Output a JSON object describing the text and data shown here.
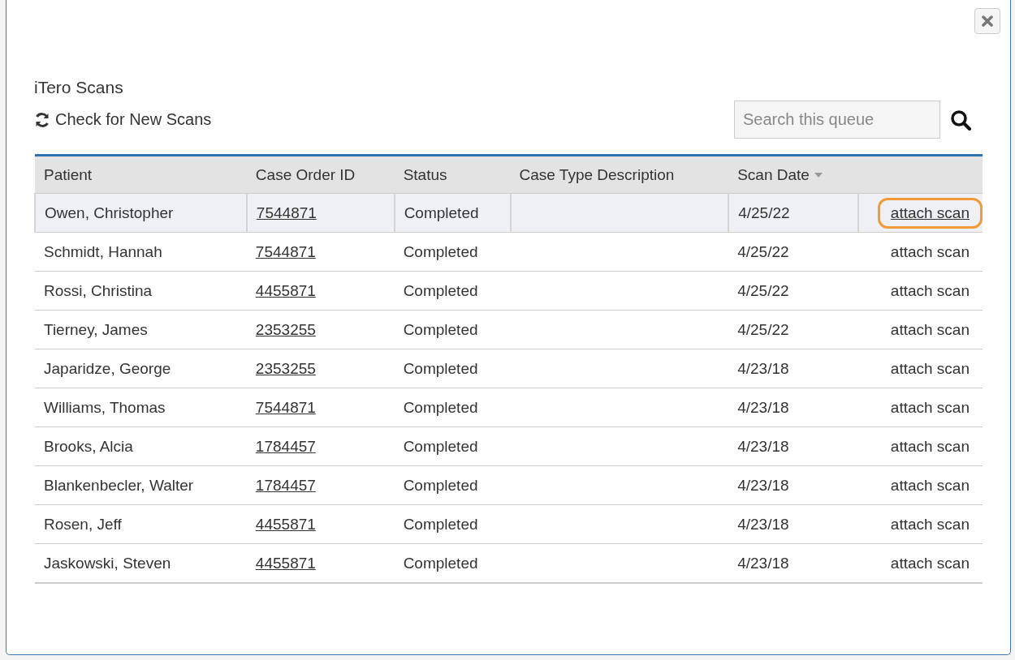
{
  "dialog": {
    "title": "iTero Scans",
    "refresh_link": "Check for New Scans",
    "search": {
      "placeholder": "Search this queue"
    }
  },
  "table": {
    "columns": [
      {
        "label": "Patient",
        "sorted": false
      },
      {
        "label": "Case Order ID",
        "sorted": false
      },
      {
        "label": "Status",
        "sorted": false
      },
      {
        "label": "Case Type Description",
        "sorted": false
      },
      {
        "label": "Scan Date",
        "sorted": true
      }
    ],
    "rows": [
      {
        "patient": "Owen, Christopher",
        "case_order_id": "7544871",
        "status": "Completed",
        "scan_date": "4/25/22",
        "action": "attach scan",
        "selected": true,
        "highlighted": true
      },
      {
        "patient": "Schmidt, Hannah",
        "case_order_id": "7544871",
        "status": "Completed",
        "scan_date": "4/25/22",
        "action": "attach scan",
        "selected": false,
        "highlighted": false
      },
      {
        "patient": "Rossi, Christina",
        "case_order_id": "4455871",
        "status": "Completed",
        "scan_date": "4/25/22",
        "action": "attach scan",
        "selected": false,
        "highlighted": false
      },
      {
        "patient": "Tierney, James",
        "case_order_id": "2353255",
        "status": "Completed",
        "scan_date": "4/25/22",
        "action": "attach scan",
        "selected": false,
        "highlighted": false
      },
      {
        "patient": "Japaridze, George",
        "case_order_id": "2353255",
        "status": "Completed",
        "scan_date": "4/23/18",
        "action": "attach scan",
        "selected": false,
        "highlighted": false
      },
      {
        "patient": "Williams, Thomas",
        "case_order_id": "7544871",
        "status": "Completed",
        "scan_date": "4/23/18",
        "action": "attach scan",
        "selected": false,
        "highlighted": false
      },
      {
        "patient": "Brooks, Alcia",
        "case_order_id": "1784457",
        "status": "Completed",
        "scan_date": "4/23/18",
        "action": "attach scan",
        "selected": false,
        "highlighted": false
      },
      {
        "patient": "Blankenbecler, Walter",
        "case_order_id": "1784457",
        "status": "Completed",
        "scan_date": "4/23/18",
        "action": "attach scan",
        "selected": false,
        "highlighted": false
      },
      {
        "patient": "Rosen, Jeff",
        "case_order_id": "4455871",
        "status": "Completed",
        "scan_date": "4/23/18",
        "action": "attach scan",
        "selected": false,
        "highlighted": false
      },
      {
        "patient": "Jaskowski, Steven",
        "case_order_id": "4455871",
        "status": "Completed",
        "scan_date": "4/23/18",
        "action": "attach scan",
        "selected": false,
        "highlighted": false
      }
    ]
  }
}
